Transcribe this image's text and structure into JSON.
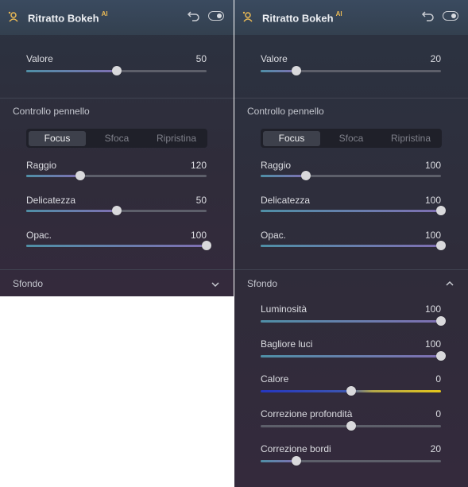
{
  "panels": [
    {
      "header": {
        "title": "Ritratto Bokeh",
        "badge": "AI",
        "icon": "bokeh-portrait-icon"
      },
      "valore": {
        "label": "Valore",
        "value": "50",
        "level": 0.5
      },
      "brush_section": {
        "title": "Controllo pennello"
      },
      "brush_tabs": [
        "Focus",
        "Sfoca",
        "Ripristina"
      ],
      "brush_active": "Focus",
      "raggio": {
        "label": "Raggio",
        "value": "120",
        "level": 0.3
      },
      "delicatezza": {
        "label": "Delicatezza",
        "value": "50",
        "level": 0.5
      },
      "opac": {
        "label": "Opac.",
        "value": "100",
        "level": 1.0
      },
      "background_section": {
        "title": "Sfondo",
        "expanded": false
      }
    },
    {
      "header": {
        "title": "Ritratto Bokeh",
        "badge": "AI",
        "icon": "bokeh-portrait-icon"
      },
      "valore": {
        "label": "Valore",
        "value": "20",
        "level": 0.2
      },
      "brush_section": {
        "title": "Controllo pennello"
      },
      "brush_tabs": [
        "Focus",
        "Sfoca",
        "Ripristina"
      ],
      "brush_active": "Focus",
      "raggio": {
        "label": "Raggio",
        "value": "100",
        "level": 0.25
      },
      "delicatezza": {
        "label": "Delicatezza",
        "value": "100",
        "level": 1.0
      },
      "opac": {
        "label": "Opac.",
        "value": "100",
        "level": 1.0
      },
      "background_section": {
        "title": "Sfondo",
        "expanded": true
      },
      "background_sliders": {
        "luminosita": {
          "label": "Luminosità",
          "value": "100",
          "level": 1.0
        },
        "bagliore": {
          "label": "Bagliore luci",
          "value": "100",
          "level": 1.0
        },
        "calore": {
          "label": "Calore",
          "value": "0",
          "level": 0.5
        },
        "profondita": {
          "label": "Correzione profondità",
          "value": "0",
          "level": 0.5
        },
        "bordi": {
          "label": "Correzione bordi",
          "value": "20",
          "level": 0.2
        }
      }
    }
  ],
  "colors": {
    "badge": "#e9b955",
    "panel_bg": "#2f2c3a",
    "header_bg": "#3a4a5f",
    "warm_end": "#e5c61a",
    "cool_end": "#2536c0"
  }
}
